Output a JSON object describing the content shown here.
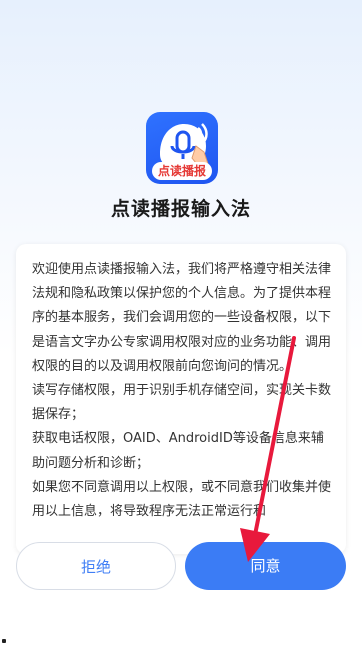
{
  "app": {
    "icon_name": "voice-input-icon",
    "icon_band_text": "点读播报",
    "title": "点读播报输入法"
  },
  "policy": {
    "paragraphs": [
      "欢迎使用点读播报输入法，我们将严格遵守相关法律法规和隐私政策以保护您的个人信息。为了提供本程序的基本服务，我们会调用您的一些设备权限，以下是语言文字办公专家调用权限对应的业务功能、调用权限的目的以及调用权限前向您询问的情况。",
      "读写存储权限，用于识别手机存储空间，实现关卡数据保存；",
      "获取电话权限，OAID、AndroidID等设备信息来辅助问题分析和诊断；",
      "如果您不同意调用以上权限，或不同意我们收集并使用以上信息，将导致程序无法正常运行和"
    ]
  },
  "buttons": {
    "reject_label": "拒绝",
    "agree_label": "同意"
  },
  "colors": {
    "primary": "#3b7cf5",
    "icon_bg": "#2f72ff",
    "annotation_arrow": "#e8193c"
  }
}
